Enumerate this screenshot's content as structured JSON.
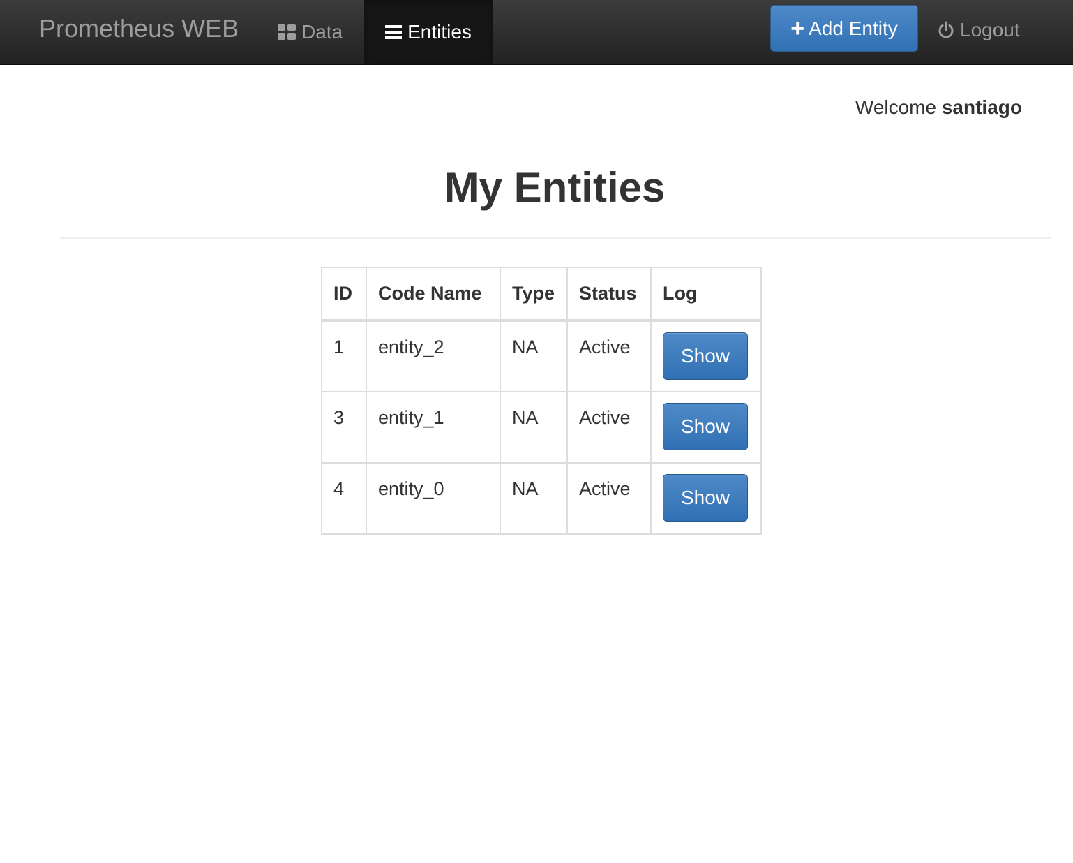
{
  "navbar": {
    "brand": "Prometheus WEB",
    "items": [
      {
        "label": "Data",
        "icon": "grid-icon",
        "active": false
      },
      {
        "label": "Entities",
        "icon": "list-icon",
        "active": true
      }
    ],
    "add_button_label": "Add Entity",
    "logout_label": "Logout"
  },
  "welcome": {
    "prefix": "Welcome",
    "username": "santiago"
  },
  "page_title": "My Entities",
  "table": {
    "columns": [
      "ID",
      "Code Name",
      "Type",
      "Status",
      "Log"
    ],
    "rows": [
      {
        "id": "1",
        "code_name": "entity_2",
        "type": "NA",
        "status": "Active",
        "log_action": "Show"
      },
      {
        "id": "3",
        "code_name": "entity_1",
        "type": "NA",
        "status": "Active",
        "log_action": "Show"
      },
      {
        "id": "4",
        "code_name": "entity_0",
        "type": "NA",
        "status": "Active",
        "log_action": "Show"
      }
    ]
  },
  "colors": {
    "navbar": "#222222",
    "primary": "#3a78bb",
    "text": "#333333",
    "muted": "#9d9d9d"
  }
}
